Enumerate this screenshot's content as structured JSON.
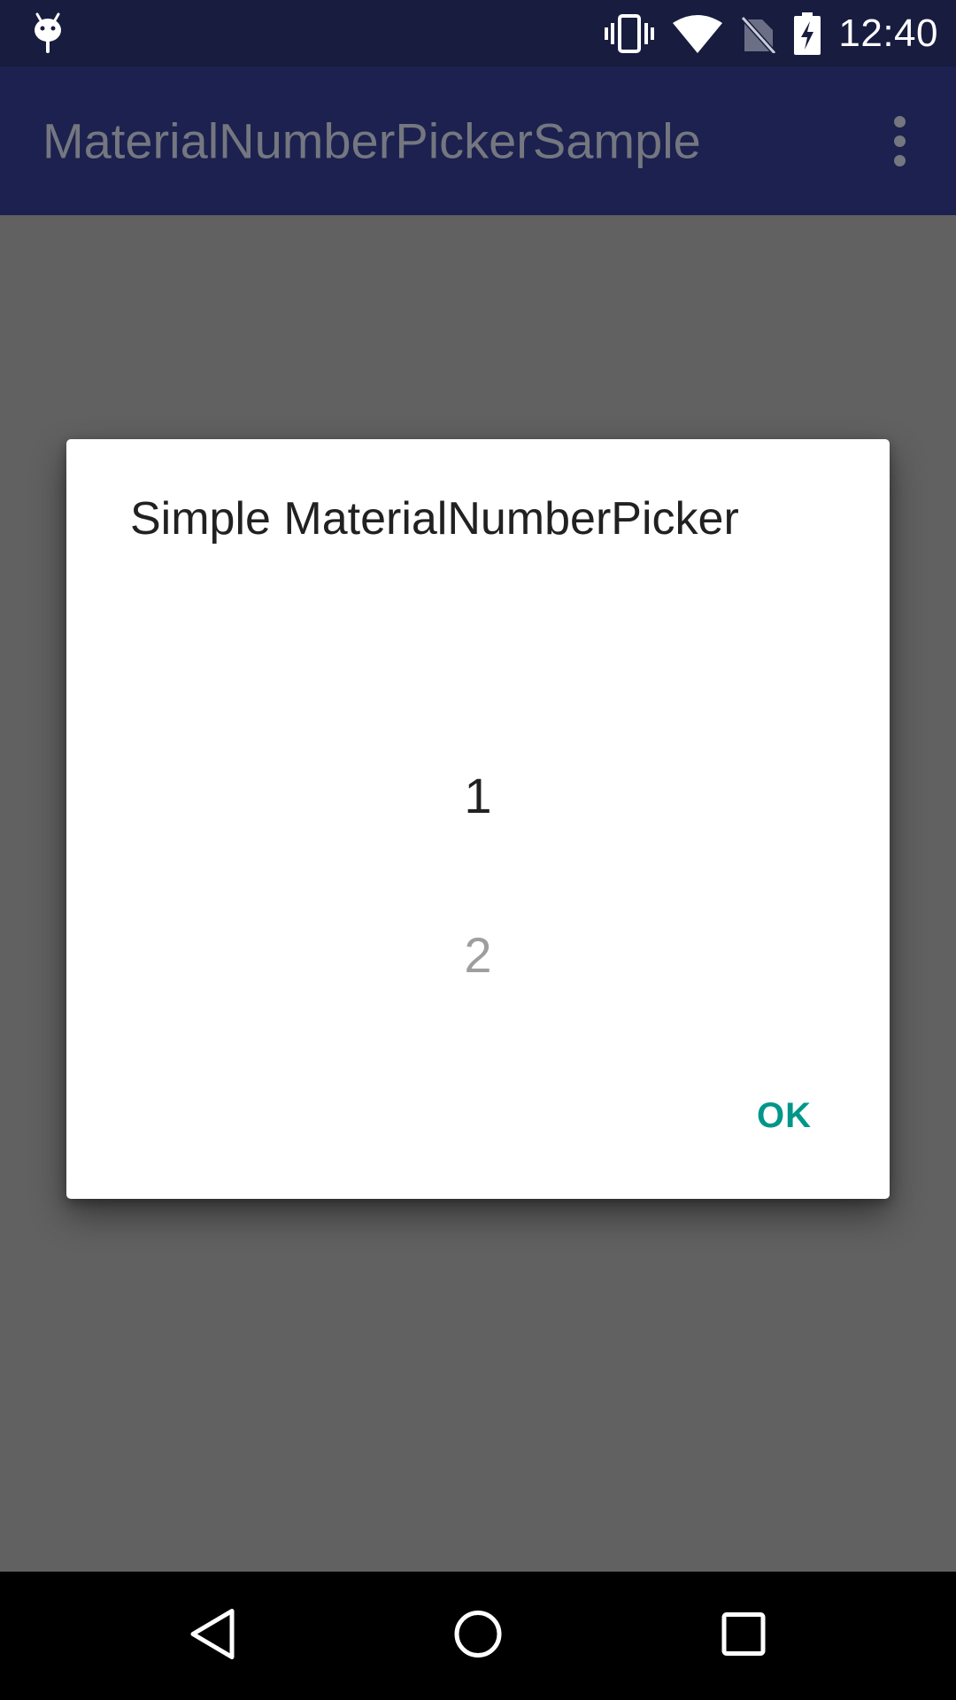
{
  "status_bar": {
    "time": "12:40",
    "icons": [
      "debug-android-icon",
      "vibrate-icon",
      "wifi-icon",
      "no-sim-icon",
      "battery-charging-icon"
    ]
  },
  "toolbar": {
    "title": "MaterialNumberPickerSample",
    "overflow_icon": "more-vert-icon"
  },
  "dialog": {
    "title": "Simple MaterialNumberPicker",
    "picker": {
      "selected_value": "1",
      "next_value": "2"
    },
    "ok_label": "OK"
  },
  "nav_bar": {
    "icons": [
      "back-icon",
      "home-icon",
      "recents-icon"
    ]
  },
  "colors": {
    "status_bar": "#181c3f",
    "toolbar": "#1c2150",
    "scrim": "#616161",
    "accent": "#00968a"
  }
}
